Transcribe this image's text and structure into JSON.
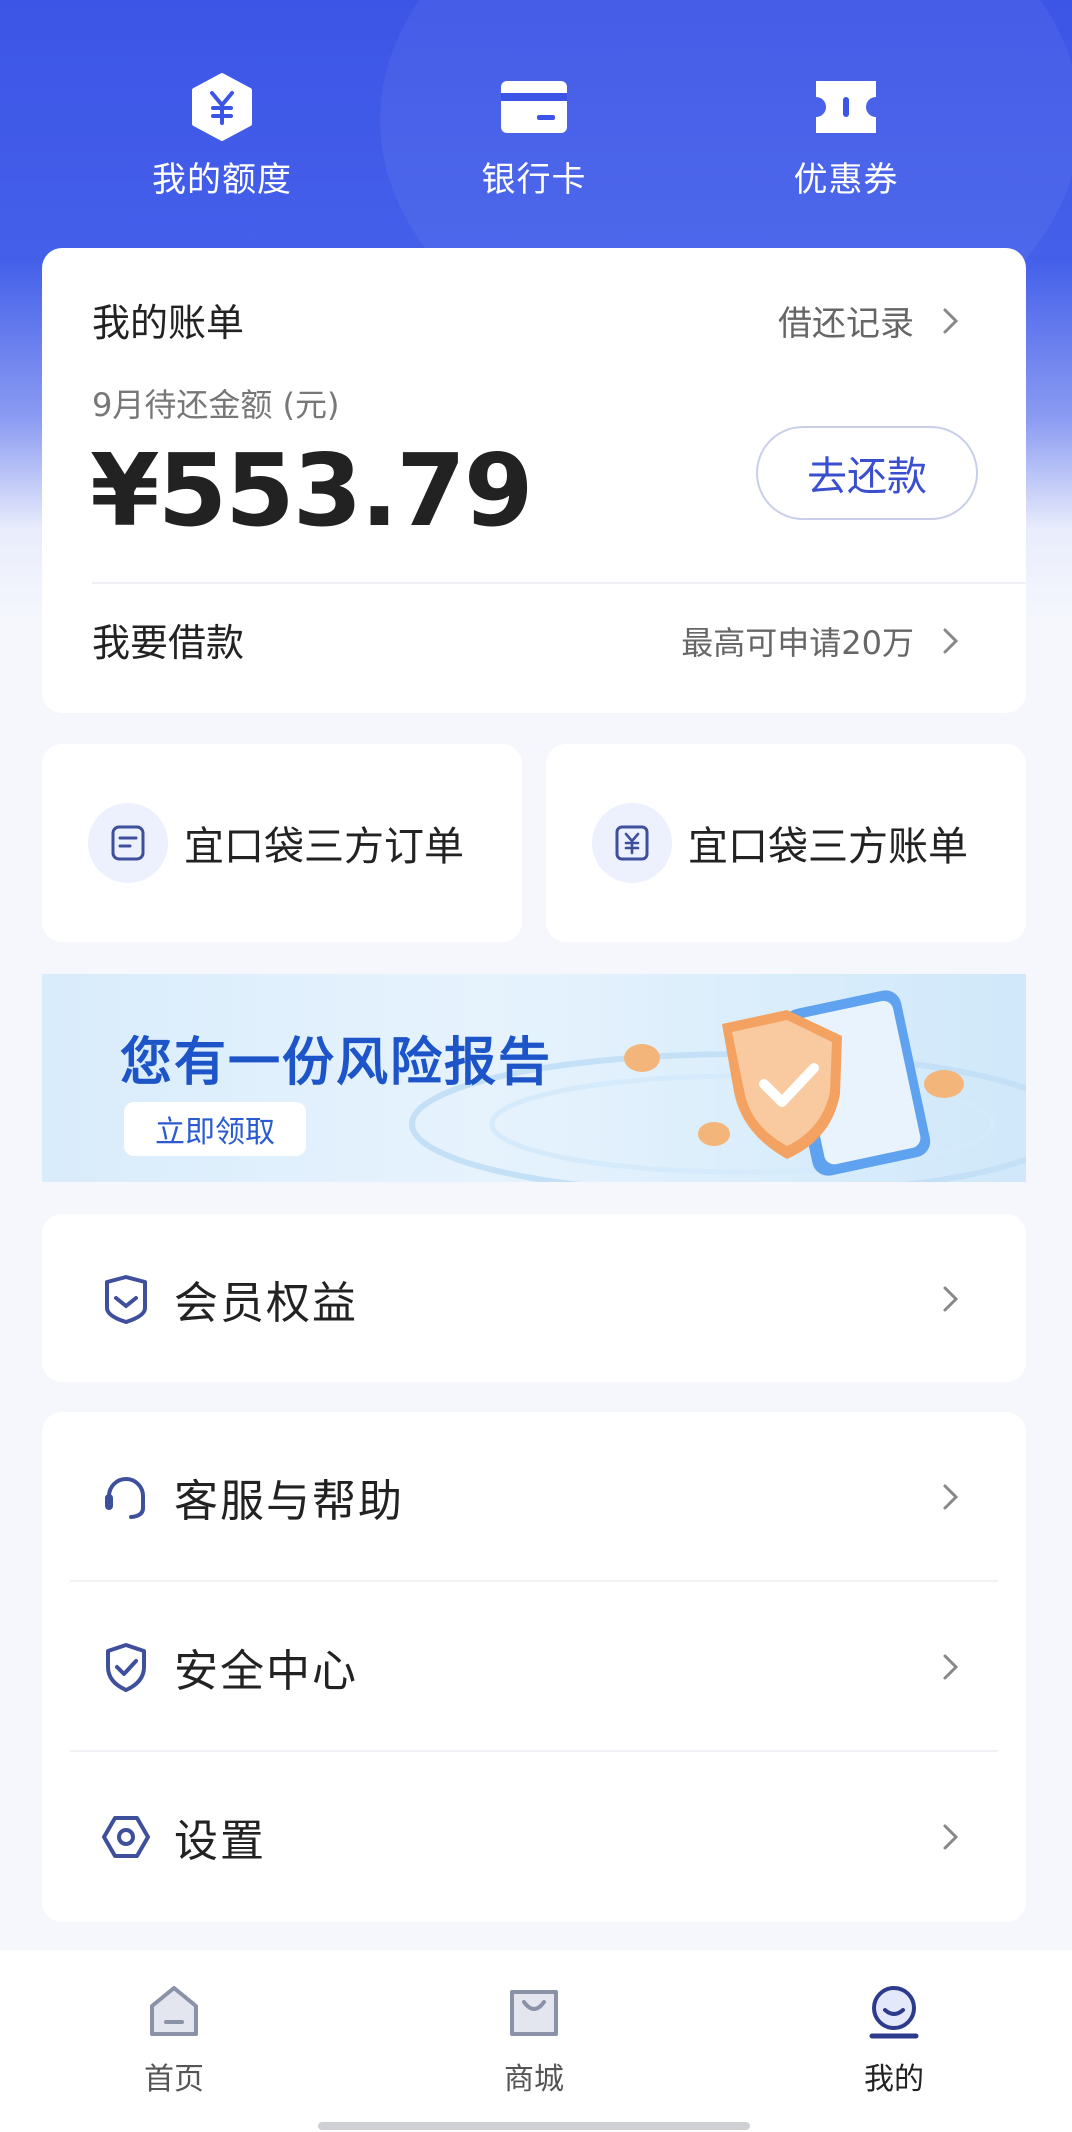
{
  "shortcuts": [
    {
      "label": "我的额度",
      "icon": "credit-limit-icon"
    },
    {
      "label": "银行卡",
      "icon": "bank-card-icon"
    },
    {
      "label": "优惠券",
      "icon": "coupon-icon"
    }
  ],
  "bill": {
    "title": "我的账单",
    "history_label": "借还记录",
    "due_label": "9月待还金额 (元)",
    "amount": "¥553.79",
    "repay_label": "去还款",
    "borrow_label": "我要借款",
    "borrow_hint": "最高可申请20万"
  },
  "quick_cards": [
    {
      "label": "宜口袋三方订单",
      "icon": "order-icon"
    },
    {
      "label": "宜口袋三方账单",
      "icon": "bill-icon"
    }
  ],
  "banner": {
    "headline": "您有一份风险报告",
    "cta": "立即领取"
  },
  "vip": {
    "label": "会员权益",
    "icon": "vip-icon"
  },
  "menu": [
    {
      "label": "客服与帮助",
      "icon": "headset-icon"
    },
    {
      "label": "安全中心",
      "icon": "shield-icon"
    },
    {
      "label": "设置",
      "icon": "settings-icon"
    }
  ],
  "tabbar": [
    {
      "label": "首页",
      "icon": "home-icon"
    },
    {
      "label": "商城",
      "icon": "shopping-bag-icon"
    },
    {
      "label": "我的",
      "icon": "profile-icon",
      "active": true
    }
  ],
  "colors": {
    "brand_blue": "#3d55e6",
    "accent_text": "#3a4fcf",
    "icon_blue": "#3e4f9c"
  }
}
